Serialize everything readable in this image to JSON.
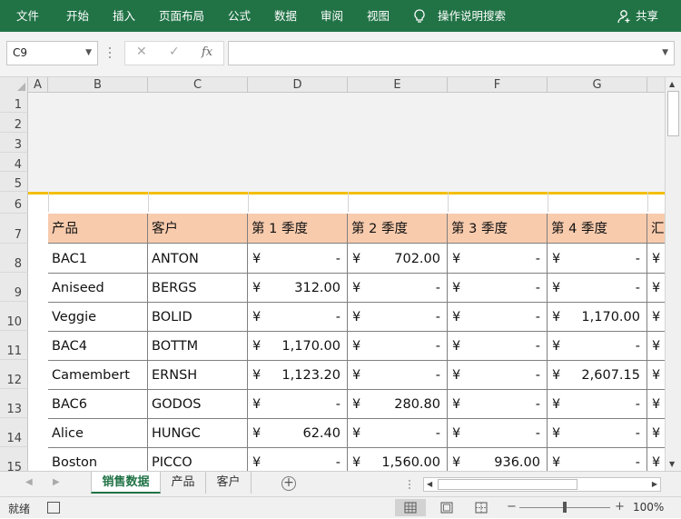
{
  "ribbon": {
    "tabs": [
      "文件",
      "开始",
      "插入",
      "页面布局",
      "公式",
      "数据",
      "审阅",
      "视图"
    ],
    "tell_me": "操作说明搜索",
    "share": "共享"
  },
  "formula_bar": {
    "name_box": "C9",
    "formula": ""
  },
  "columns": [
    "A",
    "B",
    "C",
    "D",
    "E",
    "F",
    "G"
  ],
  "rows": [
    "1",
    "2",
    "3",
    "4",
    "5",
    "6",
    "7",
    "8",
    "9",
    "10",
    "11",
    "12",
    "13",
    "14",
    "15"
  ],
  "table": {
    "headers": [
      "产品",
      "客户",
      "第 1 季度",
      "第 2 季度",
      "第 3 季度",
      "第 4 季度",
      "汇"
    ],
    "currency": "¥",
    "rows": [
      {
        "product": "BAC1",
        "customer": "ANTON",
        "q1": "-",
        "q2": "702.00",
        "q3": "-",
        "q4": "-"
      },
      {
        "product": "Aniseed",
        "customer": "BERGS",
        "q1": "312.00",
        "q2": "-",
        "q3": "-",
        "q4": "-"
      },
      {
        "product": "Veggie",
        "customer": "BOLID",
        "q1": "-",
        "q2": "-",
        "q3": "-",
        "q4": "1,170.00"
      },
      {
        "product": "BAC4",
        "customer": "BOTTM",
        "q1": "1,170.00",
        "q2": "-",
        "q3": "-",
        "q4": "-"
      },
      {
        "product": "Camembert",
        "customer": "ERNSH",
        "q1": "1,123.20",
        "q2": "-",
        "q3": "-",
        "q4": "2,607.15"
      },
      {
        "product": "BAC6",
        "customer": "GODOS",
        "q1": "-",
        "q2": "280.80",
        "q3": "-",
        "q4": "-"
      },
      {
        "product": "Alice",
        "customer": "HUNGC",
        "q1": "62.40",
        "q2": "-",
        "q3": "-",
        "q4": "-"
      },
      {
        "product": "Boston",
        "customer": "PICCO",
        "q1": "-",
        "q2": "1,560.00",
        "q3": "936.00",
        "q4": "-"
      }
    ]
  },
  "sheet_tabs": [
    "销售数据",
    "产品",
    "客户"
  ],
  "status": {
    "ready": "就绪",
    "zoom": "100%"
  },
  "colors": {
    "ribbon": "#217346",
    "header_fill": "#f8cbad",
    "accent_line": "#f4bf00"
  }
}
